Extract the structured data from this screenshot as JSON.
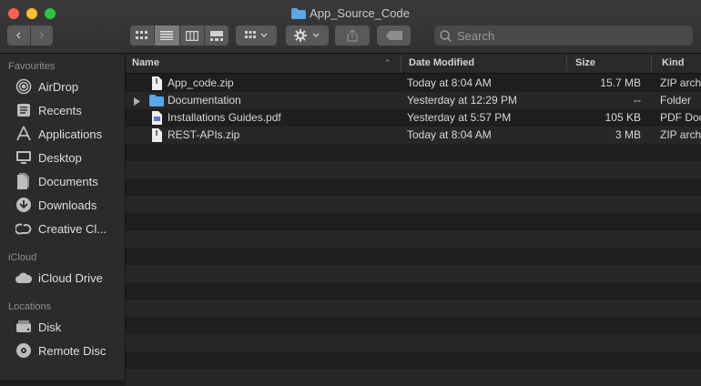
{
  "window": {
    "title": "App_Source_Code"
  },
  "toolbar": {
    "search_placeholder": "Search"
  },
  "sidebar": {
    "sections": [
      {
        "label": "Favourites",
        "items": [
          {
            "label": "AirDrop",
            "icon": "airdrop-icon"
          },
          {
            "label": "Recents",
            "icon": "recents-icon"
          },
          {
            "label": "Applications",
            "icon": "applications-icon"
          },
          {
            "label": "Desktop",
            "icon": "desktop-icon"
          },
          {
            "label": "Documents",
            "icon": "documents-icon"
          },
          {
            "label": "Downloads",
            "icon": "downloads-icon"
          },
          {
            "label": "Creative Cl...",
            "icon": "creative-cloud-icon"
          }
        ]
      },
      {
        "label": "iCloud",
        "items": [
          {
            "label": "iCloud Drive",
            "icon": "icloud-icon"
          }
        ]
      },
      {
        "label": "Locations",
        "items": [
          {
            "label": "Disk",
            "icon": "disk-icon"
          },
          {
            "label": "Remote Disc",
            "icon": "remote-disc-icon"
          }
        ]
      }
    ]
  },
  "columns": {
    "name": "Name",
    "date": "Date Modified",
    "size": "Size",
    "kind": "Kind"
  },
  "files": [
    {
      "name": "App_code.zip",
      "date": "Today at 8:04 AM",
      "size": "15.7 MB",
      "kind": "ZIP archive",
      "icon": "zip-file-icon"
    },
    {
      "name": "Documentation",
      "date": "Yesterday at 12:29 PM",
      "size": "--",
      "kind": "Folder",
      "icon": "folder-icon"
    },
    {
      "name": "Installations Guides.pdf",
      "date": "Yesterday at 5:57 PM",
      "size": "105 KB",
      "kind": "PDF Document",
      "icon": "pdf-file-icon"
    },
    {
      "name": "REST-APIs.zip",
      "date": "Today at 8:04 AM",
      "size": "3 MB",
      "kind": "ZIP archive",
      "icon": "zip-file-icon"
    }
  ],
  "colors": {
    "accent_folder": "#5aa8e6",
    "close": "#fe5f57",
    "minimize": "#febc2e",
    "zoom": "#28c840"
  }
}
